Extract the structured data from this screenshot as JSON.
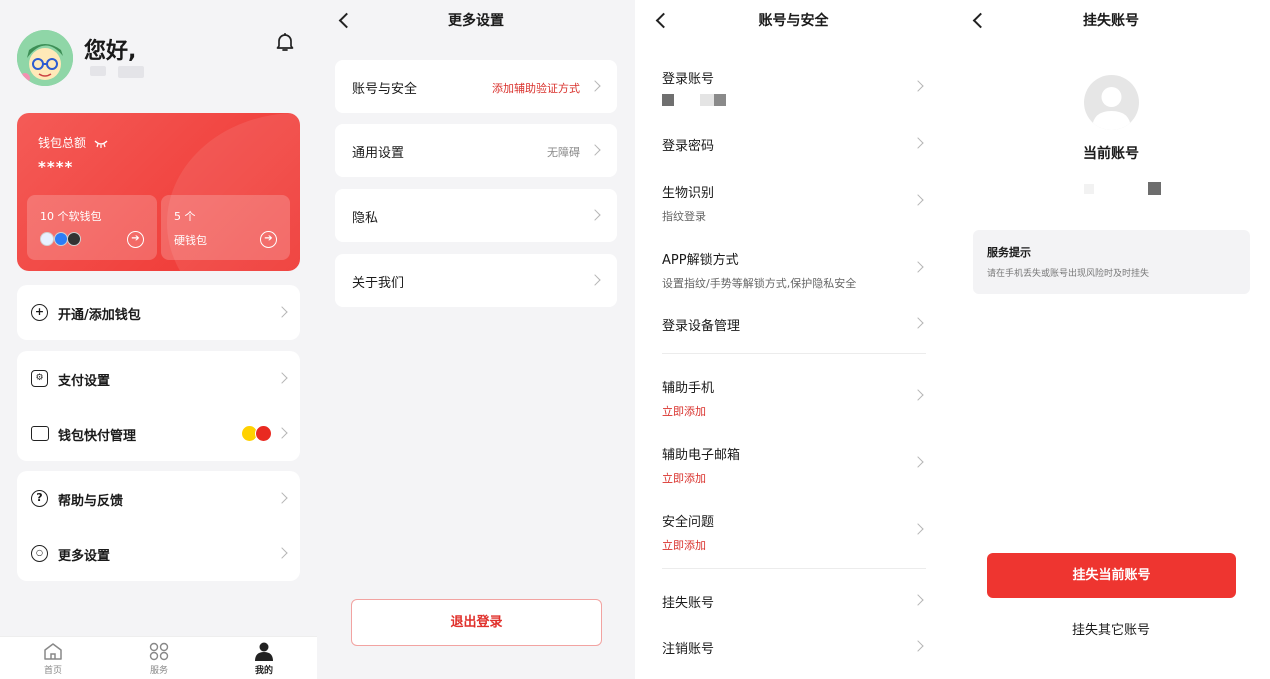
{
  "home": {
    "greeting": "您好,",
    "wallet": {
      "title": "钱包总额",
      "amount_masked": "****",
      "soft_wallet_label": "10 个软钱包",
      "hard_wallet_count": "5 个",
      "hard_wallet_label": "硬钱包"
    },
    "menu": [
      {
        "label": "开通/添加钱包",
        "icon": "plus-circle-icon"
      },
      {
        "label": "支付设置",
        "icon": "payment-settings-icon"
      },
      {
        "label": "钱包快付管理",
        "icon": "wallet-icon"
      },
      {
        "label": "帮助与反馈",
        "icon": "help-icon"
      },
      {
        "label": "更多设置",
        "icon": "settings-hexagon-icon"
      }
    ],
    "tabs": [
      "首页",
      "服务",
      "我的"
    ],
    "colors": {
      "accent": "#ef3430",
      "background": "#f4f4f6"
    }
  },
  "more_settings": {
    "title": "更多设置",
    "items": [
      {
        "label": "账号与安全",
        "value": "添加辅助验证方式"
      },
      {
        "label": "通用设置",
        "value": "无障碍"
      },
      {
        "label": "隐私",
        "value": ""
      },
      {
        "label": "关于我们",
        "value": ""
      }
    ],
    "logout_label": "退出登录"
  },
  "account_security": {
    "title": "账号与安全",
    "items": [
      {
        "label": "登录账号",
        "sub": ""
      },
      {
        "label": "登录密码",
        "sub": ""
      },
      {
        "label": "生物识别",
        "sub": "指纹登录"
      },
      {
        "label": "APP解锁方式",
        "sub": "设置指纹/手势等解锁方式,保护隐私安全"
      },
      {
        "label": "登录设备管理",
        "sub": ""
      },
      {
        "label": "辅助手机",
        "sub": "立即添加"
      },
      {
        "label": "辅助电子邮箱",
        "sub": "立即添加"
      },
      {
        "label": "安全问题",
        "sub": "立即添加"
      },
      {
        "label": "挂失账号",
        "sub": ""
      },
      {
        "label": "注销账号",
        "sub": ""
      }
    ]
  },
  "report_loss": {
    "title": "挂失账号",
    "current_account_label": "当前账号",
    "tip_title": "服务提示",
    "tip_body": "请在手机丢失或账号出现风险时及时挂失",
    "primary_button": "挂失当前账号",
    "secondary_button": "挂失其它账号"
  }
}
